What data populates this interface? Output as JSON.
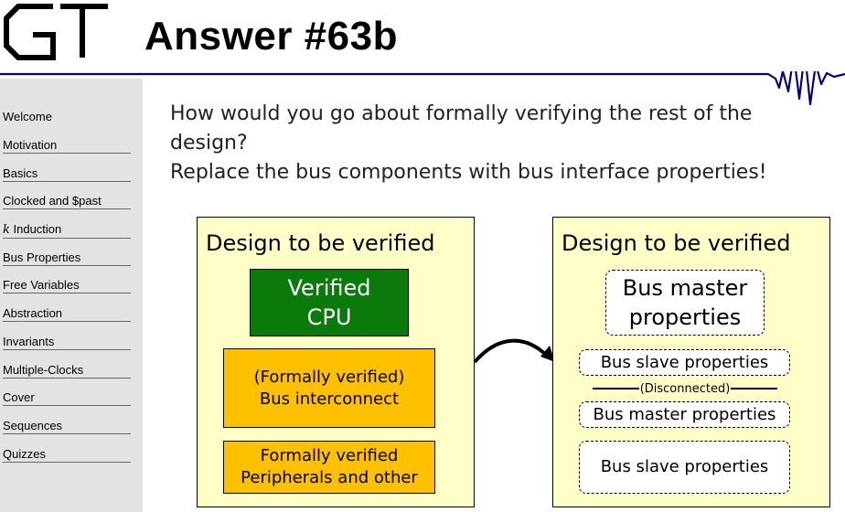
{
  "header": {
    "logo_label": "GT",
    "title": "Answer #63b"
  },
  "sidebar": {
    "items": [
      {
        "label": "Welcome"
      },
      {
        "label": "Motivation"
      },
      {
        "label": "Basics"
      },
      {
        "label": "Clocked and $past"
      },
      {
        "prefix": "k",
        "label": " Induction"
      },
      {
        "label": "Bus Properties"
      },
      {
        "label": "Free Variables"
      },
      {
        "label": "Abstraction"
      },
      {
        "label": "Invariants"
      },
      {
        "label": "Multiple-Clocks"
      },
      {
        "label": "Cover"
      },
      {
        "label": "Sequences"
      },
      {
        "label": "Quizzes"
      }
    ]
  },
  "question": {
    "line1": "How would you go about formally verifying the rest of the",
    "line2": "design?",
    "line3": "Replace the bus components with bus interface properties!"
  },
  "left_panel": {
    "title": "Design to be verified",
    "cpu": [
      "Verified",
      "CPU"
    ],
    "interconnect": [
      "(Formally verified)",
      "Bus interconnect"
    ],
    "peripherals": [
      "Formally verified",
      "Peripherals and other"
    ]
  },
  "right_panel": {
    "title": "Design to be verified",
    "master_top": [
      "Bus master",
      "properties"
    ],
    "slave_props": "Bus slave properties",
    "disconnected": "(Disconnected)",
    "master_props": "Bus master properties",
    "slave_bottom": "Bus slave properties"
  },
  "colors": {
    "accent_line": "#00007f",
    "cpu_green": "#0a7a0a",
    "orange": "#ffc000",
    "panel_yellow": "#ffffc8",
    "sidebar_gray": "#e3e3e3"
  }
}
